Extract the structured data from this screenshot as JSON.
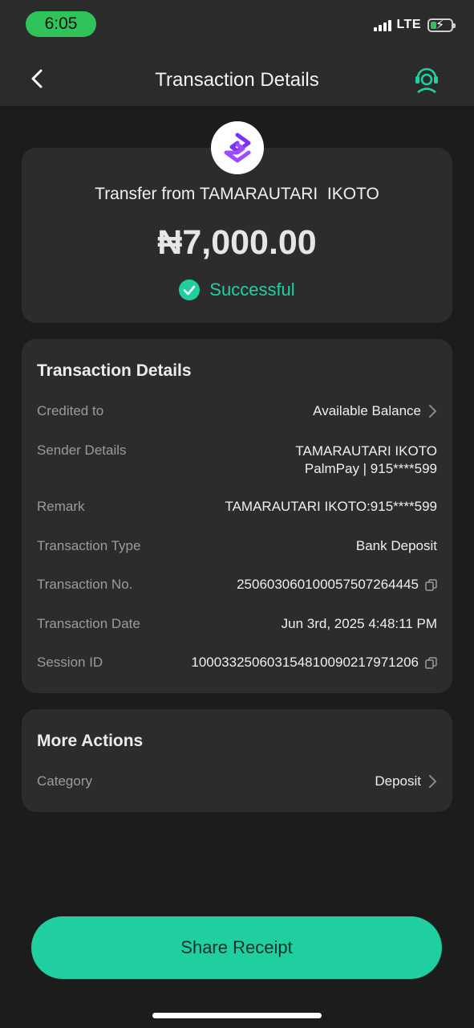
{
  "status_bar": {
    "time": "6:05",
    "network": "LTE"
  },
  "header": {
    "title": "Transaction Details"
  },
  "summary": {
    "title": "Transfer from TAMARAUTARI  IKOTO",
    "amount": "₦7,000.00",
    "status": "Successful"
  },
  "details": {
    "heading": "Transaction Details",
    "credited_to": {
      "label": "Credited to",
      "value": "Available Balance"
    },
    "sender": {
      "label": "Sender Details",
      "name": "TAMARAUTARI IKOTO",
      "account": "PalmPay | 915****599"
    },
    "remark": {
      "label": "Remark",
      "value": "TAMARAUTARI IKOTO:915****599"
    },
    "type": {
      "label": "Transaction Type",
      "value": "Bank Deposit"
    },
    "number": {
      "label": "Transaction No.",
      "value": "250603060100057507264445"
    },
    "date": {
      "label": "Transaction Date",
      "value": "Jun 3rd, 2025 4:48:11 PM"
    },
    "session": {
      "label": "Session ID",
      "value": "100033250603154810090217971206"
    }
  },
  "more_actions": {
    "heading": "More Actions",
    "category": {
      "label": "Category",
      "value": "Deposit"
    }
  },
  "share_label": "Share Receipt",
  "colors": {
    "accent": "#1fcf9f",
    "background": "#1c1c1c",
    "card": "#2c2c2c",
    "brand_purple": "#7b2ff7"
  },
  "icons": {
    "back": "chevron-left-icon",
    "support": "headset-icon",
    "logo": "palmpay-logo-icon",
    "success": "check-circle-icon",
    "copy": "copy-icon",
    "chevron": "chevron-right-icon"
  }
}
